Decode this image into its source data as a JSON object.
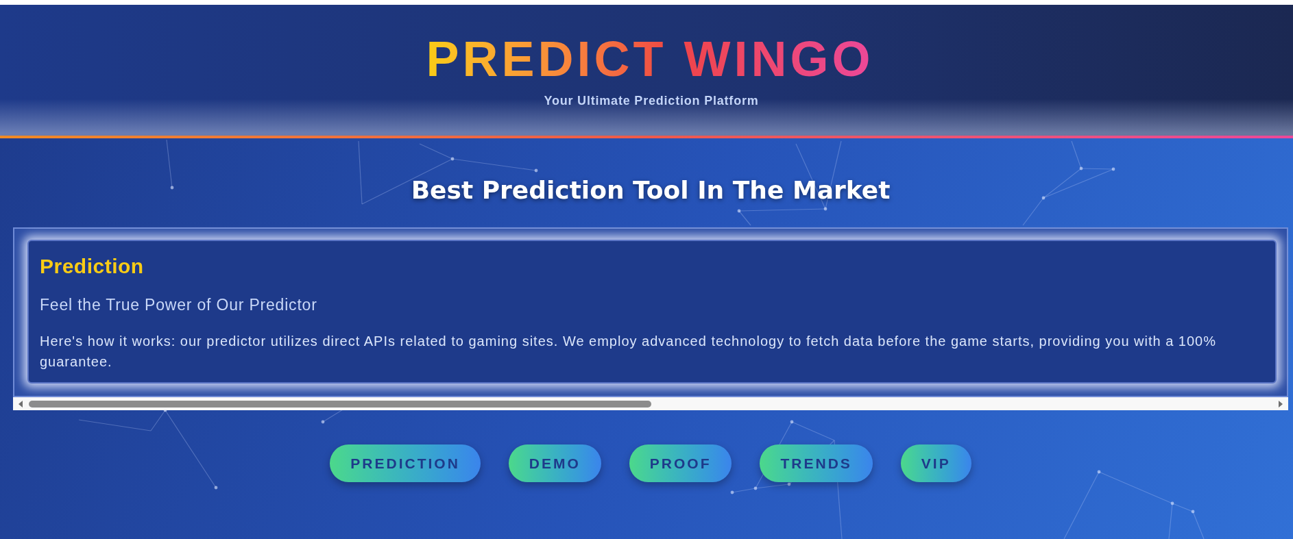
{
  "header": {
    "title": "PREDICT WINGO",
    "subtitle": "Your Ultimate Prediction Platform"
  },
  "hero": {
    "heading": "Best Prediction Tool In The Market"
  },
  "card": {
    "title": "Prediction",
    "subtitle": "Feel the True Power of Our Predictor",
    "body": "Here's how it works: our predictor utilizes direct APIs related to gaming sites. We employ advanced technology to fetch data before the game starts, providing you with a 100% guarantee."
  },
  "nav_buttons": [
    {
      "label": "PREDICTION"
    },
    {
      "label": "DEMO"
    },
    {
      "label": "PROOF"
    },
    {
      "label": "TRENDS"
    },
    {
      "label": "VIP"
    }
  ]
}
